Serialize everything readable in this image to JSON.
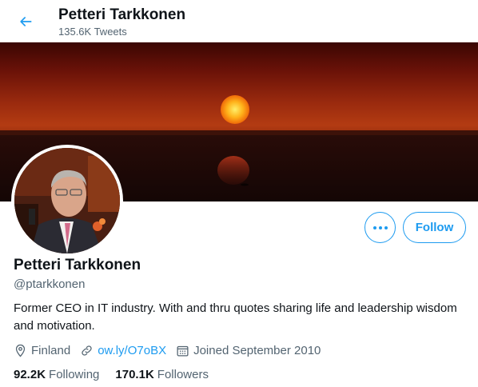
{
  "header": {
    "name": "Petteri Tarkkonen",
    "tweets_count": "135.6K Tweets"
  },
  "profile": {
    "name": "Petteri Tarkkonen",
    "handle": "@ptarkkonen",
    "bio": "Former CEO in IT industry. With and thru quotes sharing life and leadership wisdom and motivation.",
    "location": "Finland",
    "link": "ow.ly/O7oBX",
    "joined": "Joined September 2010"
  },
  "actions": {
    "follow_label": "Follow"
  },
  "stats": {
    "following_count": "92.2K",
    "following_label": "Following",
    "followers_count": "170.1K",
    "followers_label": "Followers"
  },
  "colors": {
    "accent": "#1d9bf0",
    "secondary_text": "#536471"
  }
}
